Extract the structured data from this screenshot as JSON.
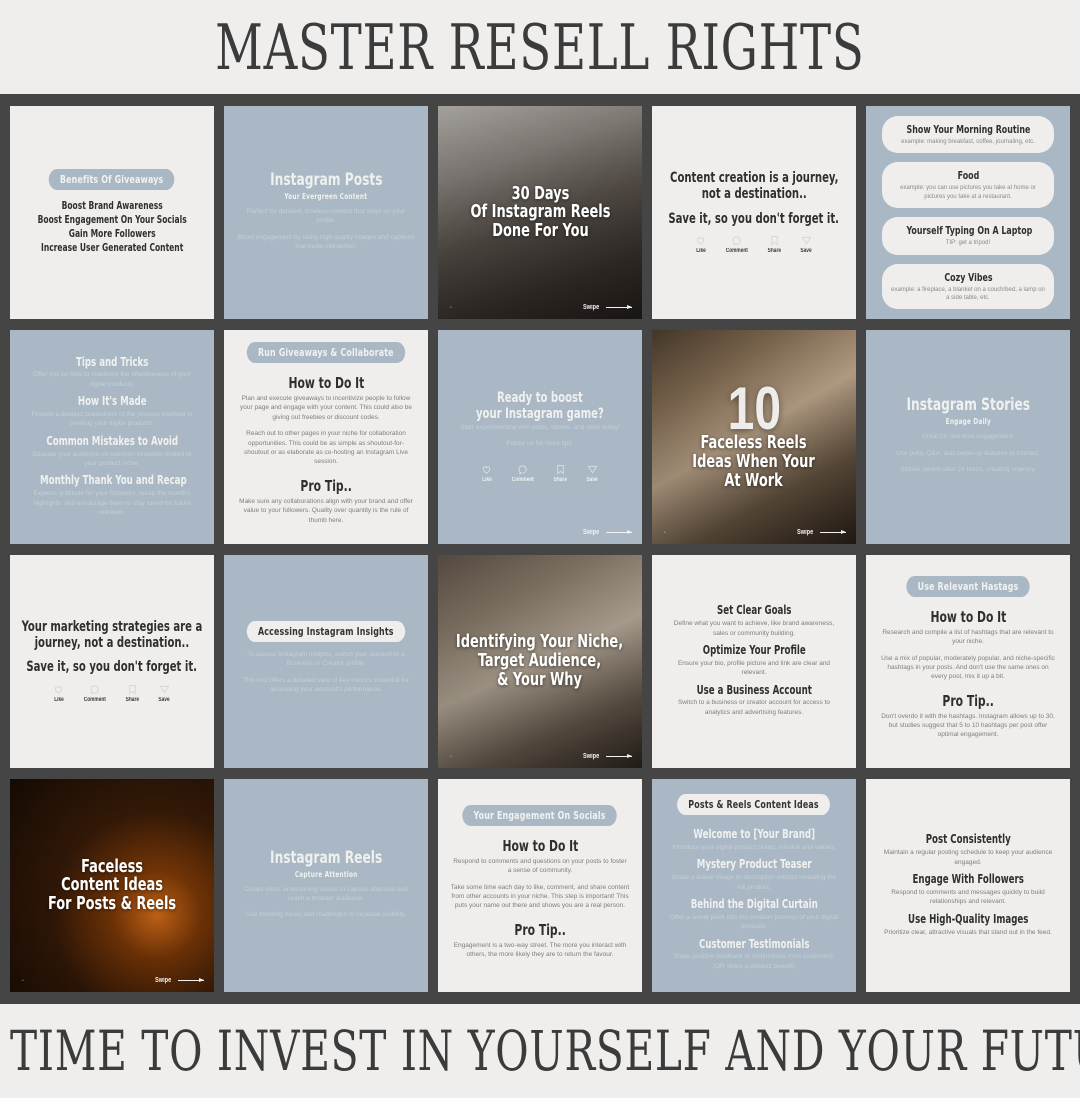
{
  "header": {
    "title": "MASTER RESELL RIGHTS"
  },
  "footer": {
    "title": "IT'S TIME TO INVEST IN YOURSELF AND YOUR FUTURE"
  },
  "colors": {
    "page_background": "#efeeec",
    "board_background": "#454545",
    "card_light": "#efeeec",
    "card_blue": "#a9b8c4",
    "heading_dark": "#2f2f2f",
    "body_muted": "#7e7e7e"
  },
  "engagement_actions": [
    "Like",
    "Comment",
    "Share",
    "Save"
  ],
  "swipe_label": "Swipe",
  "cards": [
    {
      "id": "benefits-of-giveaways",
      "style": "light",
      "pill": "Benefits Of Giveaways",
      "lines": [
        "Boost Brand Awareness",
        "Boost Engagement On Your Socials",
        "Gain More Followers",
        "Increase User Generated Content"
      ]
    },
    {
      "id": "instagram-posts",
      "style": "blue",
      "title": "Instagram Posts",
      "subtitle": "Your Evergreen Content",
      "paragraphs": [
        "Perfect for detailed, timeless content that stays on your profile.",
        "Boost engagement by using high-quality images and captions that invite interaction."
      ]
    },
    {
      "id": "30-days-reels",
      "style": "photo",
      "photo": "woman-in-grey-hoodie-against-concrete-wall",
      "caption": [
        "30 Days",
        "Of Instagram Reels",
        "Done For You"
      ],
      "swipe": true
    },
    {
      "id": "content-creation-journey-quote",
      "style": "light",
      "quote": [
        "Content creation is a journey,",
        "not a destination.."
      ],
      "cta": "Save it, so you don't forget it.",
      "show_actions": true
    },
    {
      "id": "faceless-content-chips",
      "style": "blue",
      "chips": [
        {
          "title": "Show Your Morning Routine",
          "sub": "example: making breakfast, coffee, journaling, etc."
        },
        {
          "title": "Food",
          "sub": "example: you can use pictures you take at home or pictures you take at a restaurant."
        },
        {
          "title": "Yourself Typing On A Laptop",
          "sub": "TIP: get a tripod!"
        },
        {
          "title": "Cozy Vibes",
          "sub": "example: a fireplace, a blanket on a couch/bed, a lamp on a side table, etc."
        }
      ]
    },
    {
      "id": "tips-and-tricks",
      "style": "blue",
      "sections": [
        {
          "heading": "Tips and Tricks",
          "body": "Offer tips on how to maximize the effectiveness of your digital products."
        },
        {
          "heading": "How It's Made",
          "body": "Provide a detailed breakdown of the process involved in creating your digital products."
        },
        {
          "heading": "Common Mistakes to Avoid",
          "body": "Educate your audience on common mistakes related to your product niche."
        },
        {
          "heading": "Monthly Thank You and Recap",
          "body": "Express gratitude for your followers, recap the month's highlights, and encourage them to stay tuned for future releases."
        }
      ]
    },
    {
      "id": "run-giveaways-collaborate",
      "style": "light",
      "pill": "Run Giveaways & Collaborate",
      "heading": "How to Do It",
      "paragraphs": [
        "Plan and execute giveaways to incentivize people to follow your page and engage with your content. This could also be giving out freebies or discount codes.",
        "Reach out to other pages in your niche for collaboration opportunities. This could be as simple as shoutout-for-shoutout or as elaborate as co-hosting an Instagram Live session."
      ],
      "pro_tip_heading": "Pro Tip..",
      "pro_tip": "Make sure any collaborations align with your brand and offer value to your followers. Quality over quantity is the rule of thumb here."
    },
    {
      "id": "ready-to-boost",
      "style": "blue",
      "quote": [
        "Ready to boost",
        "your Instagram game?"
      ],
      "paragraphs": [
        "Start experimenting with posts, stories, and reels today!",
        "Follow us for more tips."
      ],
      "show_actions": true,
      "swipe": true
    },
    {
      "id": "10-faceless-reels-ideas",
      "style": "photo",
      "photo": "woman-in-beige-blazer-typing-on-laptop",
      "number": "10",
      "caption": [
        "Faceless Reels",
        "Ideas When Your",
        "At Work"
      ],
      "swipe": true
    },
    {
      "id": "instagram-stories",
      "style": "blue",
      "title": "Instagram Stories",
      "subtitle": "Engage Daily",
      "paragraphs": [
        "Great for real-time engagement.",
        "Use polls, Q&A, and swipe-up features to interact.",
        "Stories vanish after 24 hours, creating urgency."
      ]
    },
    {
      "id": "marketing-strategies-quote",
      "style": "light",
      "quote": [
        "Your marketing strategies are a",
        "journey, not a destination.."
      ],
      "cta": "Save it, so you don't forget it.",
      "show_actions": true
    },
    {
      "id": "accessing-instagram-insights",
      "style": "blue",
      "pill": "Accessing Instagram Insights",
      "paragraphs": [
        "To access Instagram Insights, switch your account to a Business or Creator profile.",
        "This tool offers a detailed view of key metrics essential for assessing your account's performance."
      ]
    },
    {
      "id": "identifying-your-niche",
      "style": "photo",
      "photo": "woman-in-grey-blazer-and-white-crop-top",
      "caption": [
        "Identifying Your Niche,",
        "Target Audience,",
        "& Your Why"
      ],
      "swipe": true
    },
    {
      "id": "set-clear-goals",
      "style": "light",
      "sections": [
        {
          "heading": "Set Clear Goals",
          "body": "Define what you want to achieve, like brand awareness, sales or community building."
        },
        {
          "heading": "Optimize Your Profile",
          "body": "Ensure your bio, profile picture and link are clear and relevant."
        },
        {
          "heading": "Use a Business Account",
          "body": "Switch to a business or creator account for access to analytics and advertising features."
        }
      ]
    },
    {
      "id": "use-relevant-hashtags",
      "style": "light",
      "pill": "Use Relevant Hastags",
      "heading": "How to Do It",
      "paragraphs": [
        "Research and compile a list of hashtags that are relevant to your niche.",
        "Use a mix of popular, moderately popular, and niche-specific hashtags in your posts. And don't use the same ones on every post, mix it up a bit."
      ],
      "pro_tip_heading": "Pro Tip..",
      "pro_tip": "Don't overdo it with the hashtags. Instagram allows up to 30, but studies suggest that 5 to 10 hashtags per post offer optimal engagement."
    },
    {
      "id": "faceless-content-ideas",
      "style": "photo",
      "photo": "woman-with-glitter-sunglasses-warm-bokeh-lights",
      "caption": [
        "Faceless",
        "Content Ideas",
        "For Posts & Reels"
      ],
      "swipe": true
    },
    {
      "id": "instagram-reels",
      "style": "blue",
      "title": "Instagram Reels",
      "subtitle": "Capture Attention",
      "paragraphs": [
        "Create short, entertaining videos to capture attention and reach a broader audience.",
        "Use trending music and challenges to increase visibility."
      ]
    },
    {
      "id": "your-engagement-on-socials",
      "style": "light",
      "pill": "Your Engagement On Socials",
      "heading": "How to Do It",
      "paragraphs": [
        "Respond to comments and questions on your posts to foster a sense of community.",
        "Take some time each day to like, comment, and share content from other accounts in your niche. This step is important! This puts your name out there and shows you are a real person."
      ],
      "pro_tip_heading": "Pro Tip..",
      "pro_tip": "Engagement is a two-way street. The more you interact with others, the more likely they are to return the favour."
    },
    {
      "id": "posts-reels-content-ideas",
      "style": "blue",
      "pill": "Posts & Reels Content Ideas",
      "sections": [
        {
          "heading": "Welcome to [Your Brand]",
          "body": "Introduce your digital product brand, mission and values."
        },
        {
          "heading": "Mystery Product Teaser",
          "body": "Share a teaser image or description without revealing the full product."
        },
        {
          "heading": "Behind the Digital Curtain",
          "body": "Offer a sneak peek into the creation process of your digital products."
        },
        {
          "heading": "Customer Testimonials",
          "body": "Share positive feedback or testimonials from customers. (OR share a product benefit)"
        }
      ]
    },
    {
      "id": "post-consistently",
      "style": "light",
      "sections": [
        {
          "heading": "Post Consistently",
          "body": "Maintain a regular posting schedule to keep your audience engaged."
        },
        {
          "heading": "Engage With Followers",
          "body": "Respond to comments and messages quickly to build relationships and relevant."
        },
        {
          "heading": "Use High-Quality Images",
          "body": "Prioritize clear, attractive visuals that stand out in the feed."
        }
      ]
    }
  ]
}
